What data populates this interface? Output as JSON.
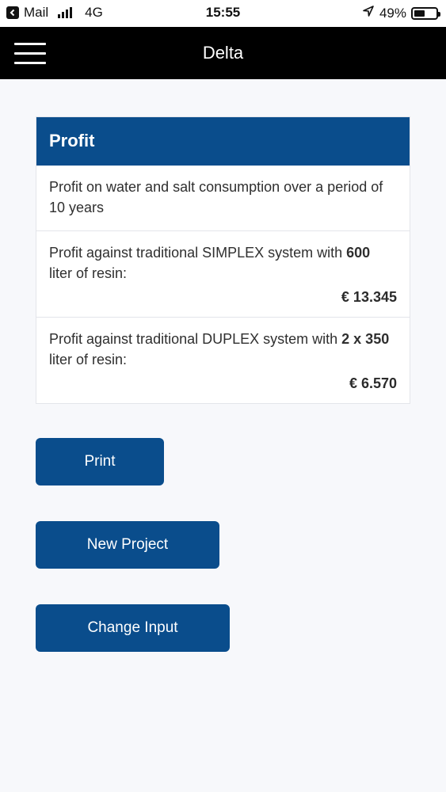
{
  "status_bar": {
    "back_app": "Mail",
    "network": "4G",
    "time": "15:55",
    "battery": "49%",
    "battery_level": 0.49
  },
  "nav": {
    "title": "Delta"
  },
  "profit_card": {
    "header": "Profit",
    "intro": "Profit on water and salt consumption over a period of 10 years",
    "simplex": {
      "prefix": "Profit against traditional SIMPLEX system with ",
      "bold": "600",
      "suffix": " liter of resin:",
      "amount": "€ 13.345"
    },
    "duplex": {
      "prefix": "Profit against traditional DUPLEX system with ",
      "bold": "2 x 350",
      "suffix": " liter of resin:",
      "amount": "€ 6.570"
    }
  },
  "actions": {
    "print": "Print",
    "new_project": "New Project",
    "change_input": "Change Input"
  },
  "colors": {
    "brand_blue": "#0a4d8c",
    "nav_bg": "#000000"
  }
}
